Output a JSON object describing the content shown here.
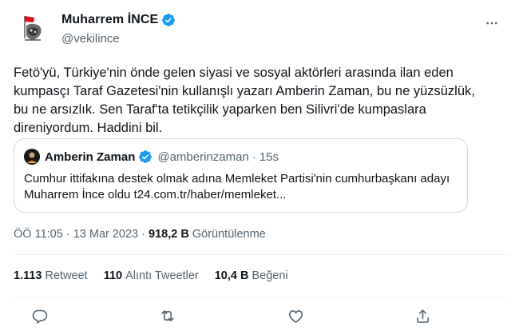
{
  "author": {
    "display_name": "Muharrem İNCE",
    "handle": "@vekilince",
    "verified_icon": "verified-badge-icon"
  },
  "tweet": {
    "text": "Fetö'yü, Türkiye'nin önde gelen siyasi ve sosyal aktörleri arasında ilan eden kumpasçı Taraf Gazetesi'nin kullanışlı yazarı Amberin Zaman, bu ne yüzsüzlük, bu ne arsızlık. Sen Taraf'ta tetikçilik yaparken ben Silivri'de kumpaslara direniyordum. Haddini bil."
  },
  "quoted_tweet": {
    "display_name": "Amberin Zaman",
    "handle": "@amberinzaman",
    "separator": "·",
    "time": "15s",
    "text": "Cumhur ittifakına destek olmak adına Memleket Partisi'nin cumhurbaşkanı adayı Muharrem İnce oldu t24.com.tr/haber/memleket..."
  },
  "meta": {
    "time": "ÖÖ 11:05",
    "separator1": "·",
    "date": "13 Mar 2023",
    "separator2": "·",
    "views_count": "918,2 B",
    "views_label": "Görüntülenme"
  },
  "stats": {
    "retweets_count": "1.113",
    "retweets_label": "Retweet",
    "quotes_count": "110",
    "quotes_label": "Alıntı Tweetler",
    "likes_count": "10,4 B",
    "likes_label": "Beğeni"
  },
  "actions": [
    "reply-icon",
    "retweet-icon",
    "like-icon",
    "share-icon"
  ],
  "colors": {
    "verified": "#1d9bf0",
    "secondary_text": "#536471",
    "primary_text": "#0f1419",
    "border": "#cfd9de"
  }
}
